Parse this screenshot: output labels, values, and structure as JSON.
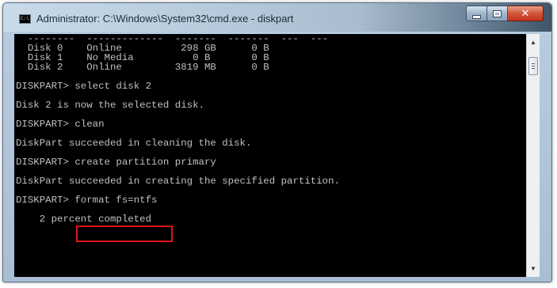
{
  "window": {
    "title": "Administrator: C:\\Windows\\System32\\cmd.exe - diskpart",
    "app_icon_text": "C:\\",
    "buttons": {
      "minimize": "minimize-icon",
      "maximize": "maximize-icon",
      "close": "close-icon"
    },
    "close_glyph": "✕"
  },
  "console": {
    "lines": [
      {
        "text": "  --------  -------------  -------  -------  ---  ---"
      },
      {
        "text": "  Disk 0    Online          298 GB      0 B"
      },
      {
        "text": "  Disk 1    No Media          0 B       0 B"
      },
      {
        "text": "  Disk 2    Online         3819 MB      0 B"
      },
      {
        "text": ""
      },
      {
        "text": "DISKPART> select disk 2"
      },
      {
        "text": ""
      },
      {
        "text": "Disk 2 is now the selected disk."
      },
      {
        "text": ""
      },
      {
        "text": "DISKPART> clean"
      },
      {
        "text": ""
      },
      {
        "text": "DiskPart succeeded in cleaning the disk."
      },
      {
        "text": ""
      },
      {
        "text": "DISKPART> create partition primary"
      },
      {
        "text": ""
      },
      {
        "text": "DiskPart succeeded in creating the specified partition."
      },
      {
        "text": ""
      },
      {
        "text": "DISKPART> format fs=ntfs"
      },
      {
        "text": ""
      },
      {
        "text": "    2 percent completed"
      }
    ],
    "highlight_color": "#e01414"
  },
  "scrollbar": {
    "up_icon": "▲",
    "down_icon": "▼"
  }
}
